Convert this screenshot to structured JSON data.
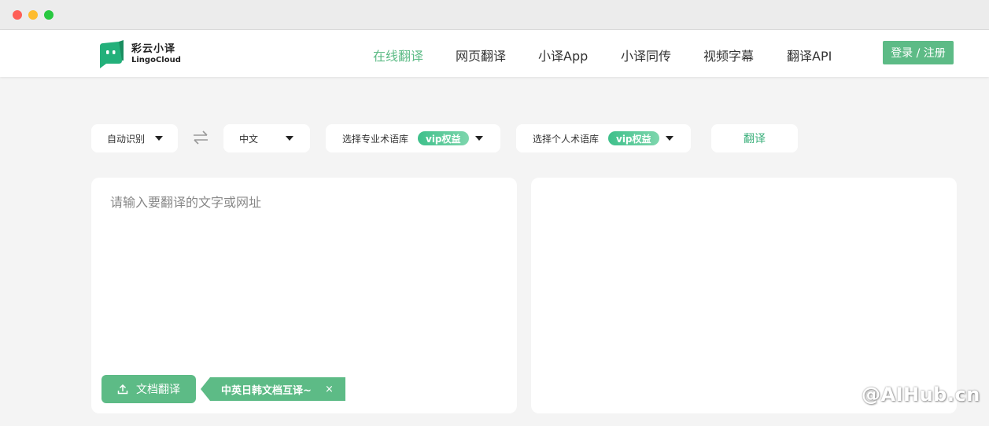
{
  "brand": {
    "name_cn": "彩云小译",
    "name_en": "LingoCloud",
    "accent": "#5dbb86",
    "logo_icon": "chat-bubble-logo"
  },
  "nav": {
    "items": [
      {
        "label": "在线翻译",
        "active": true
      },
      {
        "label": "网页翻译",
        "active": false
      },
      {
        "label": "小译App",
        "active": false
      },
      {
        "label": "小译同传",
        "active": false
      },
      {
        "label": "视频字幕",
        "active": false
      },
      {
        "label": "翻译API",
        "active": false
      }
    ],
    "login_label": "登录 / 注册"
  },
  "toolbar": {
    "source_lang": "自动识别",
    "swap_icon": "swap-arrows-icon",
    "target_lang": "中文",
    "pro_glossary": "选择专业术语库",
    "personal_glossary": "选择个人术语库",
    "vip_badge": "vip权益",
    "translate_label": "翻译"
  },
  "source_panel": {
    "placeholder": "请输入要翻译的文字或网址",
    "value": "",
    "doc_button": "文档翻译",
    "upload_icon": "upload-icon",
    "promo_text": "中英日韩文档互译~",
    "promo_close": "×"
  },
  "target_panel": {
    "value": ""
  },
  "watermark": "@AIHub.cn"
}
